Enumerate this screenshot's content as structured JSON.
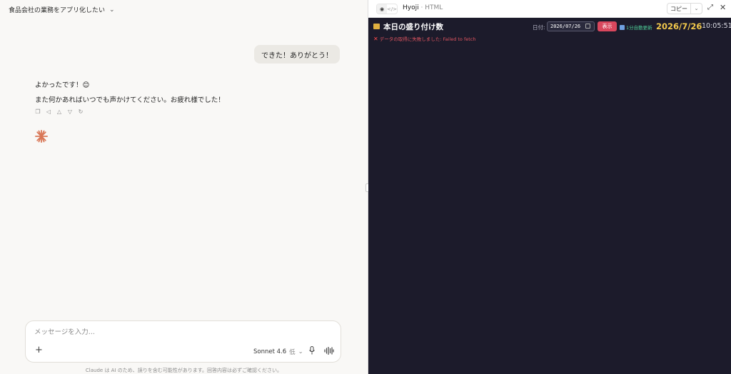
{
  "conversation": {
    "title": "食品会社の業務をアプリ化したい",
    "user_message": "できた！ありがとう！",
    "assistant_reply_1": "よかったです！😊",
    "assistant_reply_2": "また何かあればいつでも声かけてください。お疲れ様でした！"
  },
  "composer": {
    "placeholder": "メッセージを入力...",
    "plus": "+",
    "model": "Sonnet 4.6",
    "effort": "低"
  },
  "disclaimer": "Claude は AI のため、誤りを含む可能性があります。回答内容は必ずご確認ください。",
  "artifact": {
    "name": "Hyoji",
    "separator": "·",
    "type": "HTML",
    "copy_label": "コピー"
  },
  "app": {
    "title": "本日の盛り付け数",
    "date_label": "日付:",
    "date_value": "2026/07/26",
    "show_button": "表示",
    "refresh_label": "1分自動更新",
    "big_date": "2026/7/26",
    "clock": "10:05:51",
    "error": "データの取得に失敗しました: Failed to fetch"
  },
  "colors": {
    "app_bg": "#1c1b2b",
    "accent_red": "#d9475d",
    "date_yellow": "#f2c94c",
    "refresh_green": "#4fd19a",
    "error_red": "#e05560",
    "spark": "#d97757"
  }
}
